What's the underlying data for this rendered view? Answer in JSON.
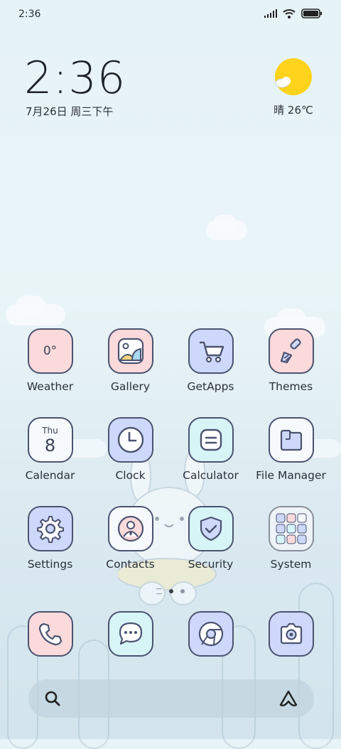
{
  "status": {
    "time": "2:36"
  },
  "clock": {
    "time": "2:36",
    "date": "7月26日 周三下午"
  },
  "weather": {
    "text": "晴 26℃"
  },
  "apps": {
    "weather": {
      "label": "Weather",
      "temp": "0°"
    },
    "gallery": {
      "label": "Gallery"
    },
    "getapps": {
      "label": "GetApps"
    },
    "themes": {
      "label": "Themes"
    },
    "calendar": {
      "label": "Calendar",
      "day": "Thu",
      "date": "8"
    },
    "clock": {
      "label": "Clock"
    },
    "calculator": {
      "label": "Calculator"
    },
    "filemanager": {
      "label": "File Manager"
    },
    "settings": {
      "label": "Settings"
    },
    "contacts": {
      "label": "Contacts"
    },
    "security": {
      "label": "Security"
    },
    "system": {
      "label": "System"
    }
  },
  "dock": {
    "items": [
      "phone-icon",
      "messaging-icon",
      "browser-icon",
      "camera-icon"
    ]
  },
  "search": {
    "left_icon": "search-icon",
    "right_icon": "assistant-icon"
  },
  "colors": {
    "pink": "#fbdadc",
    "blue": "#cdd8fb",
    "cyan": "#d7f5f7",
    "outline": "#4b5370",
    "sun": "#ffd21c"
  }
}
